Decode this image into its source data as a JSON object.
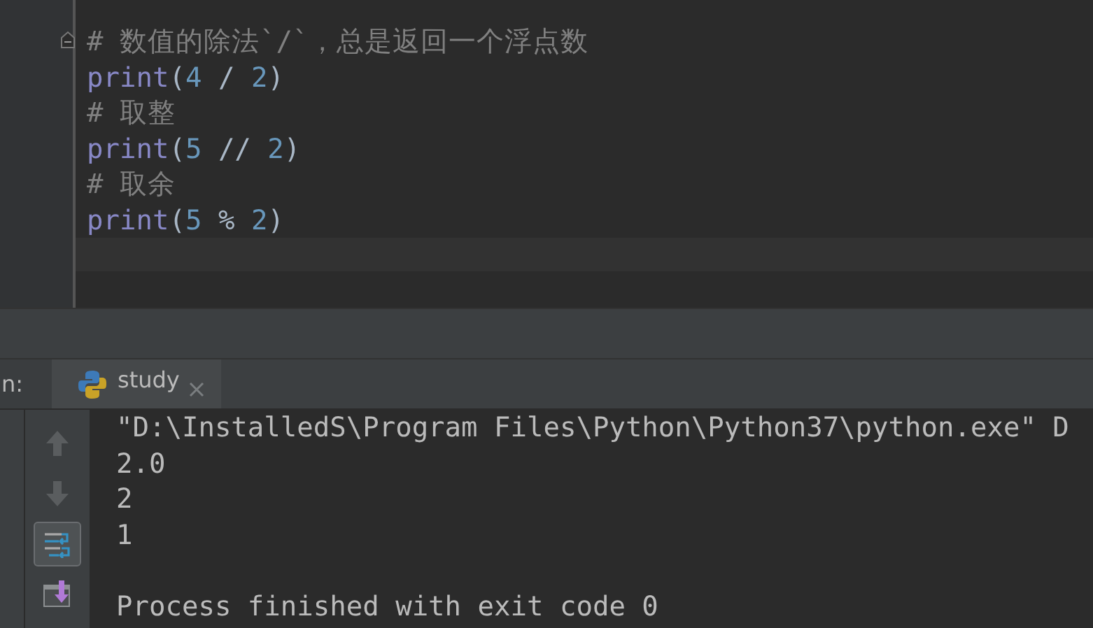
{
  "editor": {
    "lines": [
      {
        "kind": "comment",
        "folded": false,
        "text": "# 数值的除法`/`，总是返回一个浮点数"
      },
      {
        "kind": "code",
        "tokens": [
          {
            "kind": "builtin",
            "text": "print"
          },
          {
            "kind": "punct",
            "text": "("
          },
          {
            "kind": "number",
            "text": "4"
          },
          {
            "kind": "punct",
            "text": " / "
          },
          {
            "kind": "number",
            "text": "2"
          },
          {
            "kind": "punct",
            "text": ")"
          }
        ]
      },
      {
        "kind": "comment",
        "text": "# 取整"
      },
      {
        "kind": "code",
        "tokens": [
          {
            "kind": "builtin",
            "text": "print"
          },
          {
            "kind": "punct",
            "text": "("
          },
          {
            "kind": "number",
            "text": "5"
          },
          {
            "kind": "punct",
            "text": " // "
          },
          {
            "kind": "number",
            "text": "2"
          },
          {
            "kind": "punct",
            "text": ")"
          }
        ]
      },
      {
        "kind": "comment",
        "text": "# 取余"
      },
      {
        "kind": "code",
        "tokens": [
          {
            "kind": "builtin",
            "text": "print"
          },
          {
            "kind": "punct",
            "text": "("
          },
          {
            "kind": "number",
            "text": "5"
          },
          {
            "kind": "punct",
            "text": " % "
          },
          {
            "kind": "number",
            "text": "2"
          },
          {
            "kind": "punct",
            "text": ")"
          }
        ]
      }
    ]
  },
  "run_panel": {
    "label": "n:",
    "tabs": [
      {
        "label": "study",
        "selected": true
      }
    ],
    "toolbar": [
      {
        "kind": "up",
        "disabled": true,
        "selected": false
      },
      {
        "kind": "down",
        "disabled": true,
        "selected": false
      },
      {
        "kind": "wrap",
        "disabled": false,
        "selected": true
      },
      {
        "kind": "scroll-end",
        "disabled": false,
        "selected": false
      }
    ],
    "console": {
      "command": "\"D:\\InstalledS\\Program Files\\Python\\Python37\\python.exe\" D",
      "output": [
        "2.0",
        "2",
        "1"
      ],
      "exit_message": "Process finished with exit code 0"
    }
  }
}
